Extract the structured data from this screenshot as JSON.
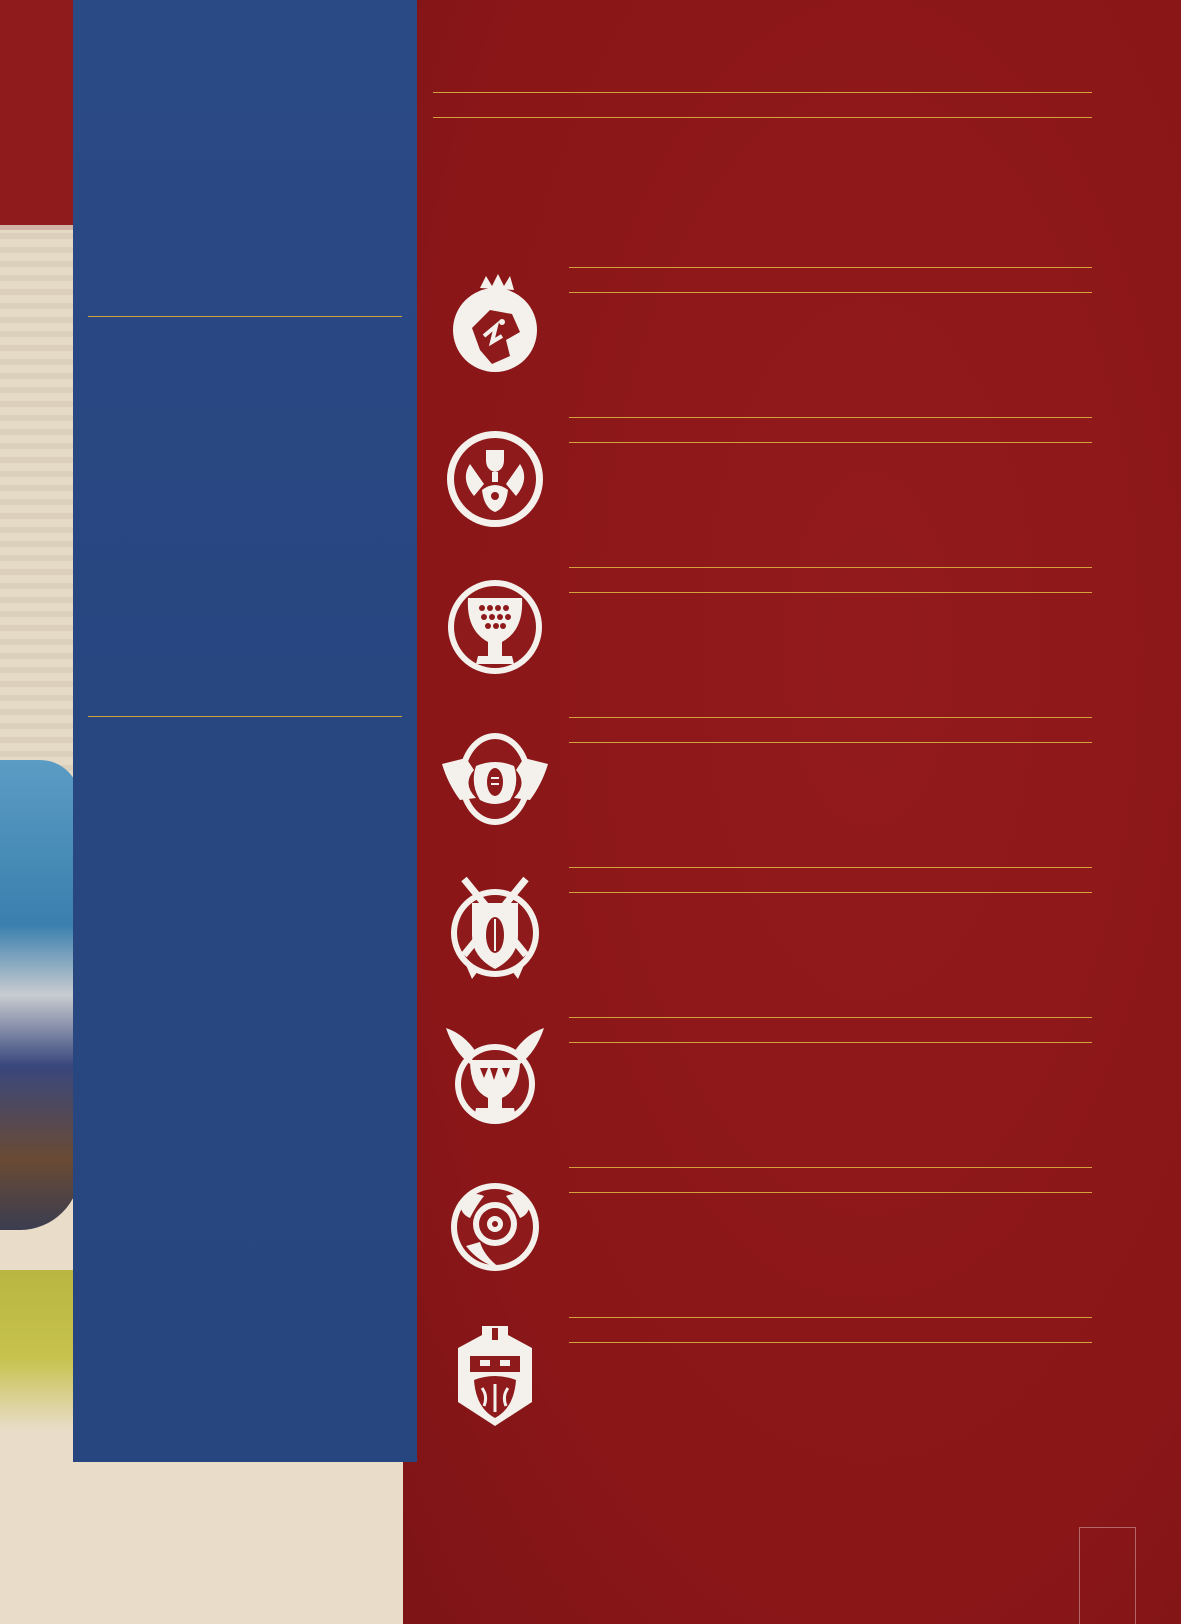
{
  "emblems": [
    {
      "name": "lion-head-crest-icon"
    },
    {
      "name": "griffin-trophy-icon"
    },
    {
      "name": "trophy-cup-icon"
    },
    {
      "name": "twin-serpent-ball-icon"
    },
    {
      "name": "crossed-swords-shield-icon"
    },
    {
      "name": "winged-chalice-icon"
    },
    {
      "name": "tentacle-eye-icon"
    },
    {
      "name": "dwarf-helm-icon"
    }
  ],
  "colors": {
    "red_panel": "#8e1a1b",
    "blue_panel": "#284680",
    "gold_rule": "#d5a23a",
    "parchment": "#e9ddc9",
    "emblem": "#f4f1ec"
  }
}
